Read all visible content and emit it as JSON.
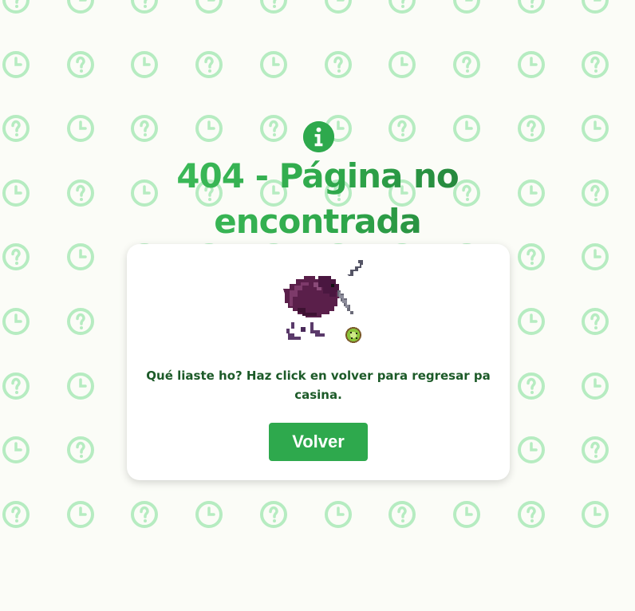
{
  "icons": {
    "header": "info-icon",
    "background": [
      "question-circle-icon",
      "clock-icon"
    ],
    "mascot": "kiwi-bird-image"
  },
  "error": {
    "title": "404 - Página no encontrada",
    "message": "Qué liaste ho? Haz click en volver para regresar pa casina.",
    "button_label": "Volver"
  },
  "colors": {
    "accent": "#2ea94d",
    "accent_dark": "#1c5a28",
    "background": "#fbfcf7",
    "pattern": "#b6ecc1",
    "card": "#ffffff"
  }
}
